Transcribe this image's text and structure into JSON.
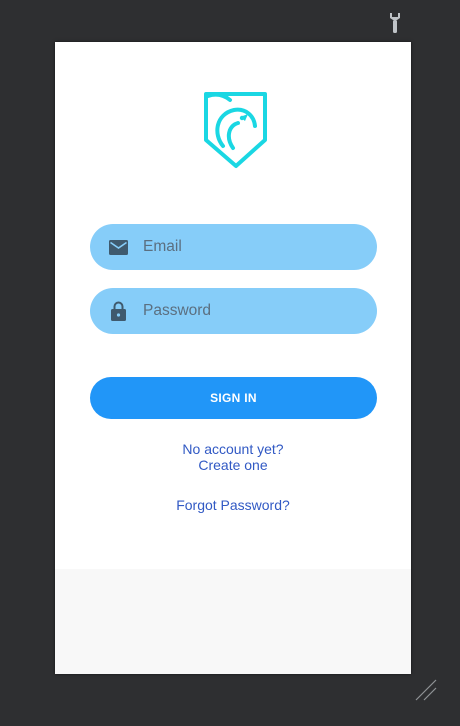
{
  "login": {
    "email_placeholder": "Email",
    "password_placeholder": "Password",
    "signin_label": "SIGN IN",
    "no_account_text": "No account yet?",
    "create_account_link": "Create one",
    "forgot_password_link": "Forgot Password?"
  },
  "icons": {
    "app_logo": "shield-bird-logo",
    "email": "envelope-icon",
    "password": "lock-icon",
    "tools": "wrench-icon",
    "resize": "resize-grip-icon"
  },
  "colors": {
    "background": "#2e2f31",
    "field_fill": "#86cdf9",
    "button_fill": "#2196f8",
    "link": "#3159c4",
    "logo": "#1ad7e3",
    "field_icon": "#3f5a6e"
  }
}
